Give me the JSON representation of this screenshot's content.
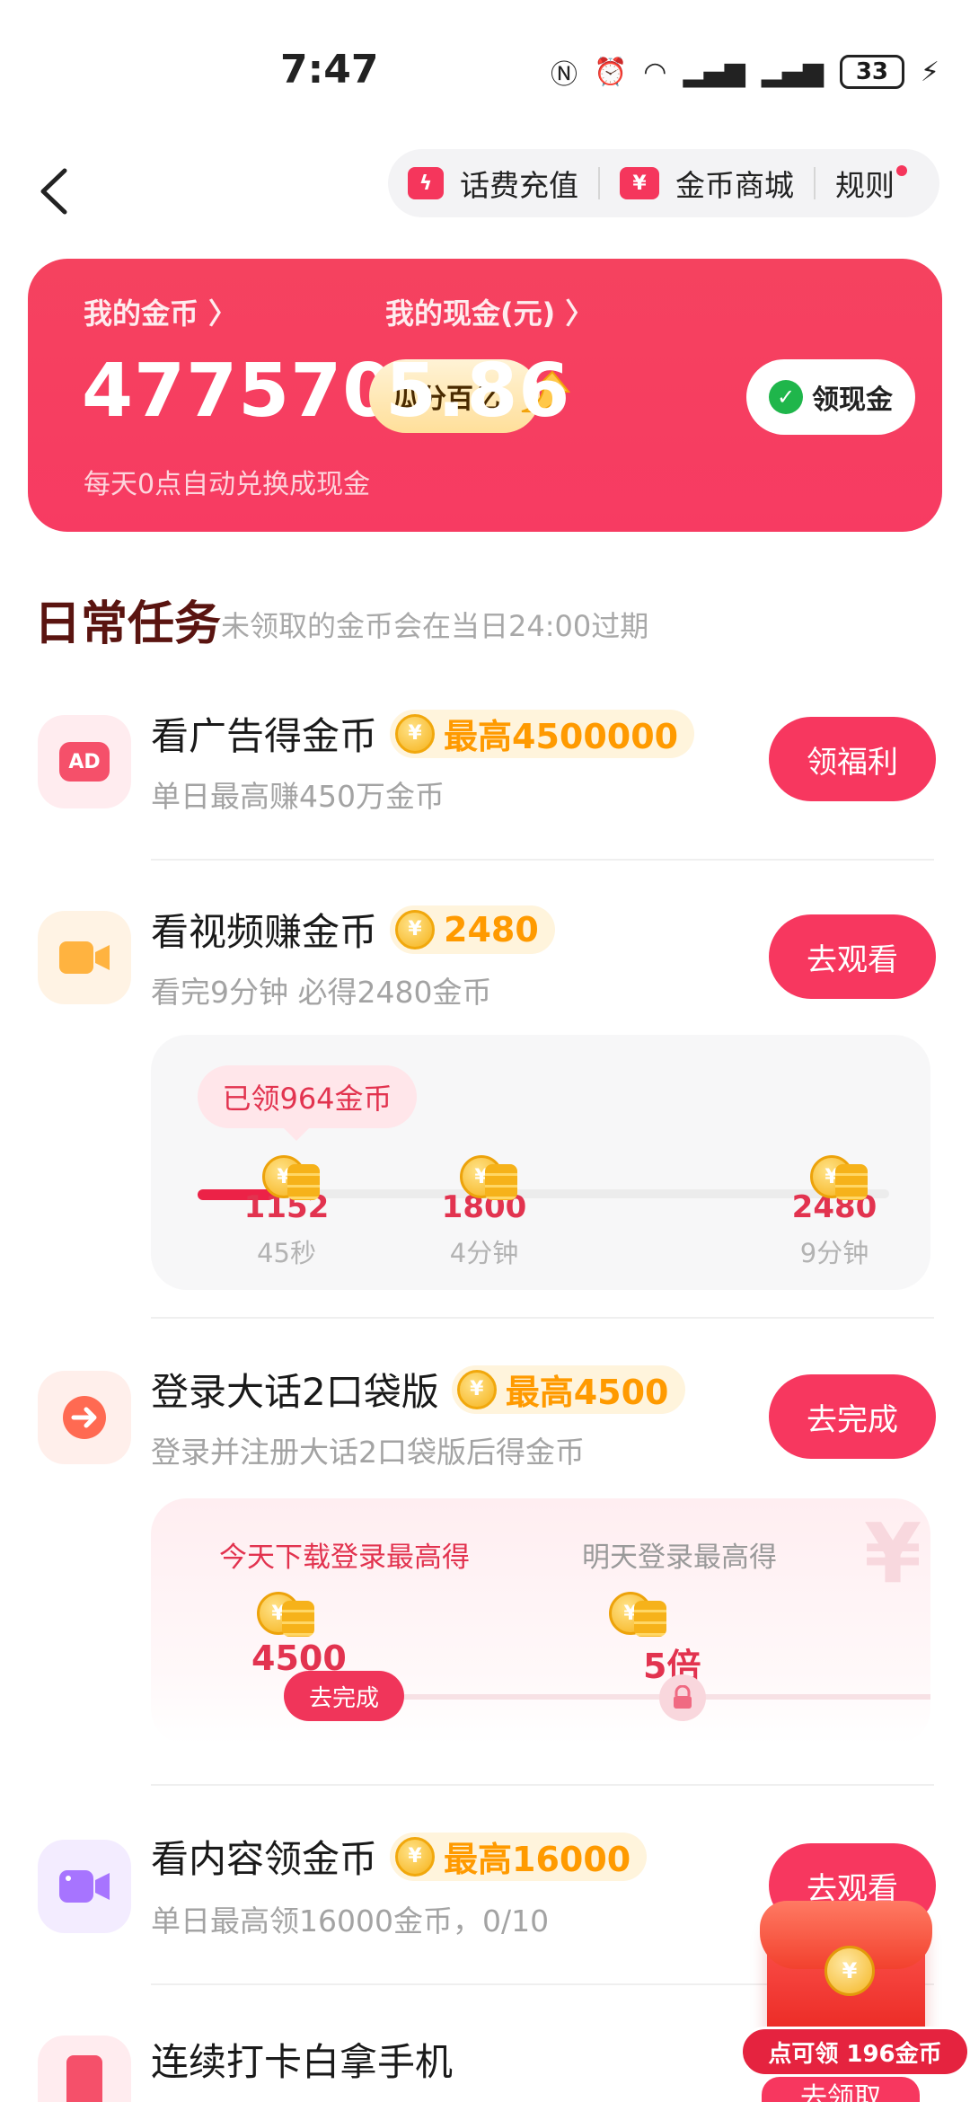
{
  "status_bar": {
    "time": "7:47",
    "battery": "33"
  },
  "header": {
    "nav_items": [
      {
        "label": "话费充值",
        "icon": "lightning-icon"
      },
      {
        "label": "金币商城",
        "icon": "yen-ticket-icon"
      },
      {
        "label": "规则",
        "icon": ""
      }
    ]
  },
  "wallet": {
    "coins_label": "我的金币 〉",
    "coins_value": "477570",
    "split_label": "瓜分百亿",
    "cash_label": "我的现金(元) 〉",
    "cash_value": "5.86",
    "cash_button": "领现金",
    "note": "每天0点自动兑换成现金"
  },
  "section": {
    "title": "日常任务",
    "note": "未领取的金币会在当日24:00过期"
  },
  "tasks": [
    {
      "title": "看广告得金币",
      "reward": "最高4500000",
      "sub": "单日最高赚450万金币",
      "button": "领福利",
      "icon_text": "AD"
    },
    {
      "title": "看视频赚金币",
      "reward": "2480",
      "sub": "看完9分钟 必得2480金币",
      "button": "去观看"
    },
    {
      "title": "登录大话2口袋版",
      "reward": "最高4500",
      "sub": "登录并注册大话2口袋版后得金币",
      "button": "去完成"
    },
    {
      "title": "看内容领金币",
      "reward": "最高16000",
      "sub": "单日最高领16000金币，0/10",
      "button": "去观看"
    },
    {
      "title": "连续打卡白拿手机"
    }
  ],
  "video_progress": {
    "claimed": "已领964金币",
    "milestones": [
      {
        "value": "1152",
        "label": "45秒"
      },
      {
        "value": "1800",
        "label": "4分钟"
      },
      {
        "value": "2480",
        "label": "9分钟"
      }
    ],
    "progress_fraction": 0.11
  },
  "login_panel": {
    "today_head": "今天下载登录最高得",
    "today_value": "4500",
    "today_button": "去完成",
    "tomorrow_head": "明天登录最高得",
    "tomorrow_value": "5倍"
  },
  "float_packet": {
    "label": "点可领 196金币",
    "button": "去领取"
  },
  "coin_glyph": "¥",
  "colors": {
    "accent": "#f7375f",
    "gold": "#ff9a00",
    "heading": "#5a1410"
  }
}
